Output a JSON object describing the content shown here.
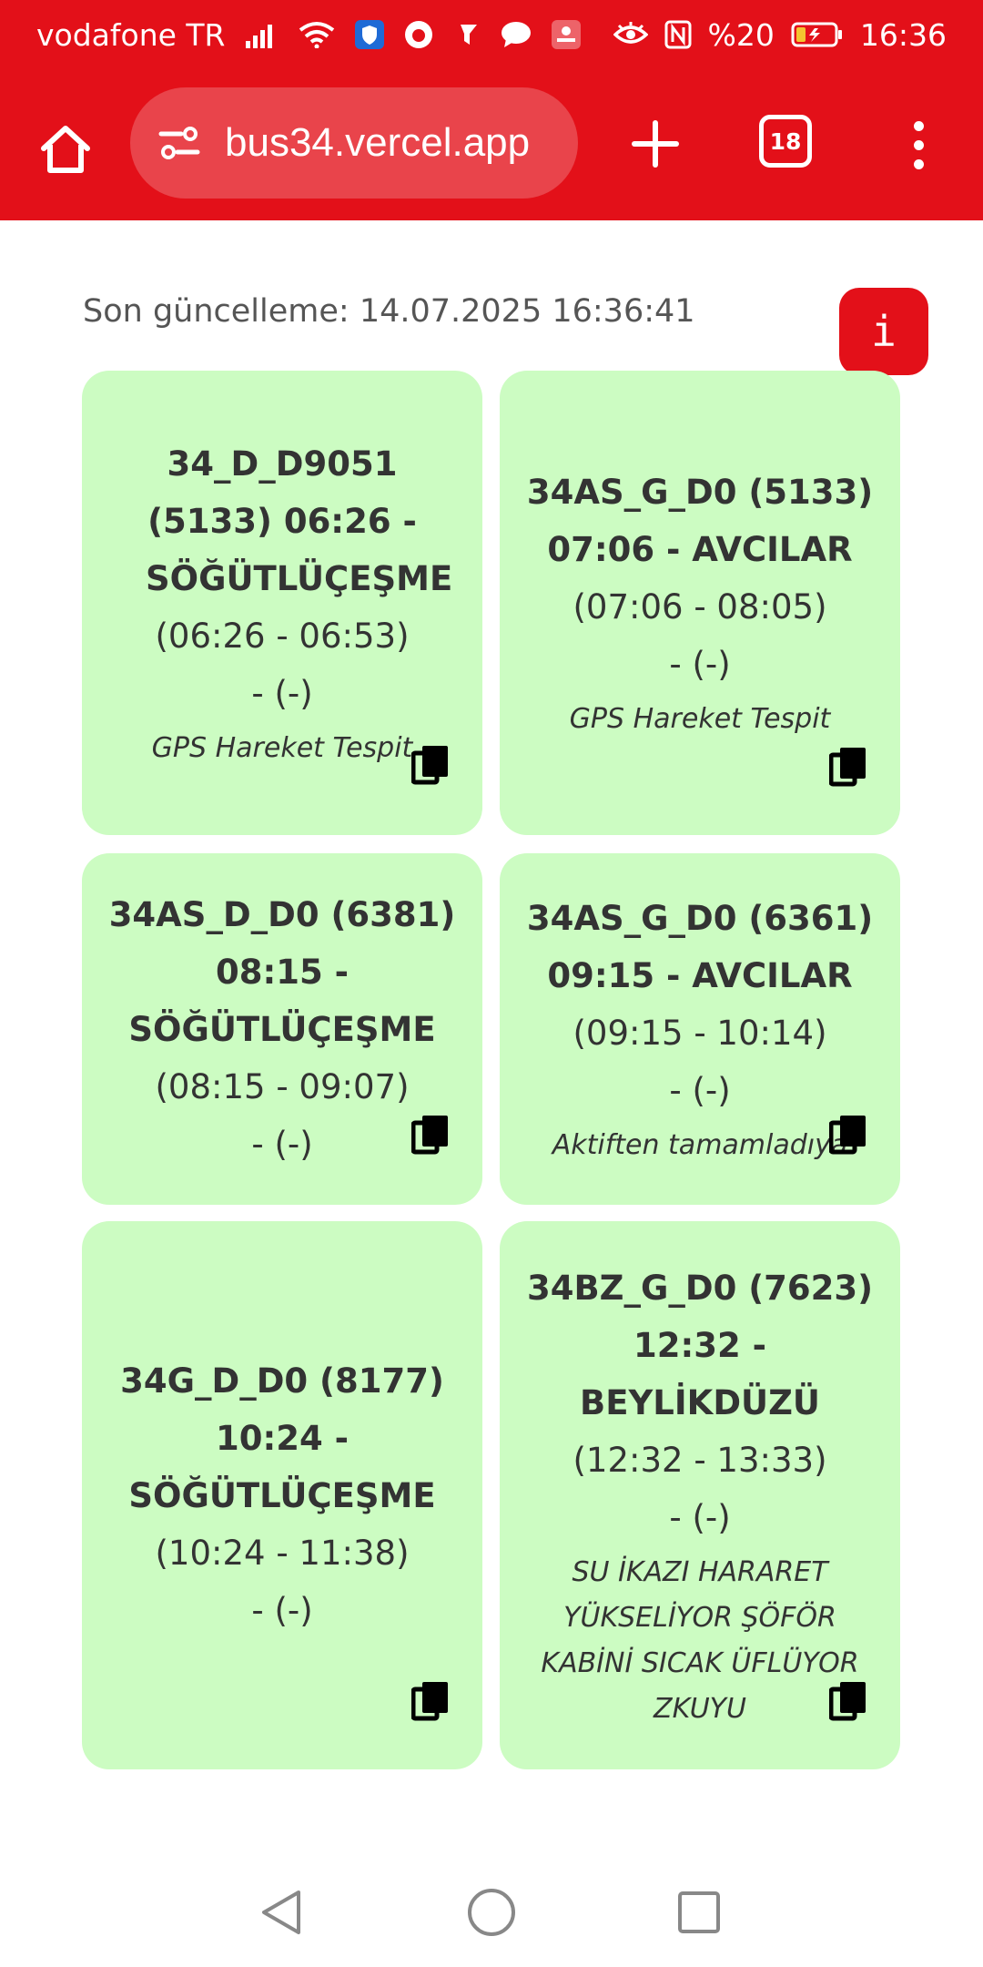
{
  "status_bar": {
    "carrier": "vodafone TR",
    "battery": "%20",
    "time": "16:36"
  },
  "browser": {
    "url": "bus34.vercel.app",
    "tab_count": "18"
  },
  "page": {
    "last_update": "Son güncelleme: 14.07.2025 16:36:41",
    "info_label": "i"
  },
  "cards": [
    {
      "title": "34_D_D9051 (5133) 06:26 - SÖĞÜTLÜÇEŞME",
      "range": "(06:26 - 06:53)",
      "extra": "- (-)",
      "note": "GPS Hareket Tespit"
    },
    {
      "title": "34AS_G_D0 (5133) 07:06 - AVCILAR",
      "range": "(07:06 - 08:05)",
      "extra": "- (-)",
      "note": "GPS Hareket Tespit"
    },
    {
      "title": "34AS_D_D0 (6381) 08:15 - SÖĞÜTLÜÇEŞME",
      "range": "(08:15 - 09:07)",
      "extra": "- (-)",
      "note": ""
    },
    {
      "title": "34AS_G_D0 (6361) 09:15 - AVCILAR",
      "range": "(09:15 - 10:14)",
      "extra": "- (-)",
      "note": "Aktiften tamamladıya"
    },
    {
      "title": "34G_D_D0 (8177) 10:24 - SÖĞÜTLÜÇEŞME",
      "range": "(10:24 - 11:38)",
      "extra": "- (-)",
      "note": ""
    },
    {
      "title": "34BZ_G_D0 (7623) 12:32 - BEYLİKDÜZÜ",
      "range": "(12:32 - 13:33)",
      "extra": "- (-)",
      "note": "SU İKAZI HARARET YÜKSELİYOR ŞÖFÖR KABİNİ SICAK ÜFLÜYOR ZKUYU"
    }
  ],
  "colors": {
    "brand_red": "#e31019",
    "card_green": "#ccfcc2"
  }
}
